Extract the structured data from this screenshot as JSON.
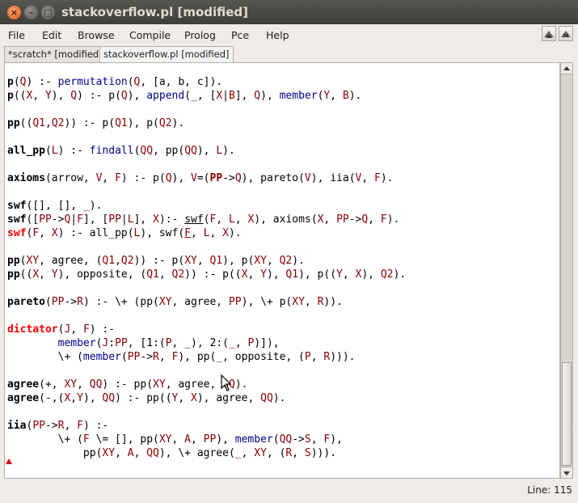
{
  "window": {
    "title": "stackoverflow.pl [modified]",
    "close_glyph": "×",
    "minimize_glyph": "–",
    "maximize_glyph": "□"
  },
  "menu": [
    "File",
    "Edit",
    "Browse",
    "Compile",
    "Prolog",
    "Pce",
    "Help"
  ],
  "toolbar_icons": [
    "split-view-icon",
    "close-view-icon"
  ],
  "tabs": [
    {
      "label": "*scratch* [modified]",
      "active": false
    },
    {
      "label": "stackoverflow.pl [modified]",
      "active": true
    }
  ],
  "code_lines": [
    [
      [
        "p",
        "h"
      ],
      [
        "(",
        "n"
      ],
      [
        "Q",
        "v"
      ],
      [
        ") :- ",
        "n"
      ],
      [
        "permutation",
        "b"
      ],
      [
        "(",
        "n"
      ],
      [
        "Q",
        "v"
      ],
      [
        ", [a, b, c]).",
        "n"
      ]
    ],
    [
      [
        "p",
        "h"
      ],
      [
        "((",
        "n"
      ],
      [
        "X",
        "v"
      ],
      [
        ", ",
        "n"
      ],
      [
        "Y",
        "v"
      ],
      [
        "), ",
        "n"
      ],
      [
        "Q",
        "v"
      ],
      [
        ") :- p(",
        "n"
      ],
      [
        "Q",
        "v"
      ],
      [
        "), ",
        "n"
      ],
      [
        "append",
        "b"
      ],
      [
        "(",
        "n"
      ],
      [
        "_",
        "v"
      ],
      [
        ", [",
        "n"
      ],
      [
        "X",
        "v"
      ],
      [
        "|",
        "n"
      ],
      [
        "B",
        "v"
      ],
      [
        "], ",
        "n"
      ],
      [
        "Q",
        "v"
      ],
      [
        "), ",
        "n"
      ],
      [
        "member",
        "b"
      ],
      [
        "(",
        "n"
      ],
      [
        "Y",
        "v"
      ],
      [
        ", ",
        "n"
      ],
      [
        "B",
        "v"
      ],
      [
        ").",
        "n"
      ]
    ],
    [],
    [
      [
        "pp",
        "h"
      ],
      [
        "((",
        "n"
      ],
      [
        "Q1",
        "v"
      ],
      [
        ",",
        "n"
      ],
      [
        "Q2",
        "v"
      ],
      [
        ")) :- p(",
        "n"
      ],
      [
        "Q1",
        "v"
      ],
      [
        "), p(",
        "n"
      ],
      [
        "Q2",
        "v"
      ],
      [
        ").",
        "n"
      ]
    ],
    [],
    [
      [
        "all_pp",
        "h"
      ],
      [
        "(",
        "n"
      ],
      [
        "L",
        "v"
      ],
      [
        ") :- ",
        "n"
      ],
      [
        "findall",
        "b"
      ],
      [
        "(",
        "n"
      ],
      [
        "QQ",
        "v"
      ],
      [
        ", pp(",
        "n"
      ],
      [
        "QQ",
        "v"
      ],
      [
        "), ",
        "n"
      ],
      [
        "L",
        "v"
      ],
      [
        ").",
        "n"
      ]
    ],
    [],
    [
      [
        "axioms",
        "h"
      ],
      [
        "(arrow, ",
        "n"
      ],
      [
        "V",
        "v"
      ],
      [
        ", ",
        "n"
      ],
      [
        "F",
        "v"
      ],
      [
        ") :- p(",
        "n"
      ],
      [
        "Q",
        "v"
      ],
      [
        "), ",
        "n"
      ],
      [
        "V",
        "v"
      ],
      [
        "=(",
        "n"
      ],
      [
        "PP",
        "hv"
      ],
      [
        "->",
        "n"
      ],
      [
        "Q",
        "v"
      ],
      [
        "), pareto(",
        "n"
      ],
      [
        "V",
        "v"
      ],
      [
        "), iia(",
        "n"
      ],
      [
        "V",
        "v"
      ],
      [
        ", ",
        "n"
      ],
      [
        "F",
        "v"
      ],
      [
        ").",
        "n"
      ]
    ],
    [],
    [
      [
        "swf",
        "h"
      ],
      [
        "([], [], ",
        "n"
      ],
      [
        "_",
        "v"
      ],
      [
        ").",
        "n"
      ]
    ],
    [
      [
        "swf",
        "h"
      ],
      [
        "([",
        "n"
      ],
      [
        "PP",
        "v"
      ],
      [
        "->",
        "n"
      ],
      [
        "Q",
        "v"
      ],
      [
        "|",
        "n"
      ],
      [
        "F",
        "v"
      ],
      [
        "], [",
        "n"
      ],
      [
        "PP",
        "v"
      ],
      [
        "|",
        "n"
      ],
      [
        "L",
        "v"
      ],
      [
        "], ",
        "n"
      ],
      [
        "X",
        "v"
      ],
      [
        "):- ",
        "n"
      ],
      [
        "swf",
        "u"
      ],
      [
        "(",
        "n"
      ],
      [
        "F",
        "v"
      ],
      [
        ", ",
        "n"
      ],
      [
        "L",
        "v"
      ],
      [
        ", ",
        "n"
      ],
      [
        "X",
        "v"
      ],
      [
        "), axioms(",
        "n"
      ],
      [
        "X",
        "v"
      ],
      [
        ", ",
        "n"
      ],
      [
        "PP",
        "v"
      ],
      [
        "->",
        "n"
      ],
      [
        "Q",
        "v"
      ],
      [
        ", ",
        "n"
      ],
      [
        "F",
        "v"
      ],
      [
        ").",
        "n"
      ]
    ],
    [
      [
        "swf",
        "hr"
      ],
      [
        "(",
        "n"
      ],
      [
        "F",
        "v"
      ],
      [
        ", ",
        "n"
      ],
      [
        "X",
        "v"
      ],
      [
        ") :- all_pp(",
        "n"
      ],
      [
        "L",
        "v"
      ],
      [
        "), swf(",
        "n"
      ],
      [
        "F",
        "vu"
      ],
      [
        ", ",
        "n"
      ],
      [
        "L",
        "v"
      ],
      [
        ", ",
        "n"
      ],
      [
        "X",
        "v"
      ],
      [
        ").",
        "n"
      ]
    ],
    [],
    [
      [
        "pp",
        "h"
      ],
      [
        "(",
        "n"
      ],
      [
        "XY",
        "v"
      ],
      [
        ", agree, (",
        "n"
      ],
      [
        "Q1",
        "v"
      ],
      [
        ",",
        "n"
      ],
      [
        "Q2",
        "v"
      ],
      [
        ")) :- p(",
        "n"
      ],
      [
        "XY",
        "v"
      ],
      [
        ", ",
        "n"
      ],
      [
        "Q1",
        "v"
      ],
      [
        "), p(",
        "n"
      ],
      [
        "XY",
        "v"
      ],
      [
        ", ",
        "n"
      ],
      [
        "Q2",
        "v"
      ],
      [
        ").",
        "n"
      ]
    ],
    [
      [
        "pp",
        "h"
      ],
      [
        "((",
        "n"
      ],
      [
        "X",
        "v"
      ],
      [
        ", ",
        "n"
      ],
      [
        "Y",
        "v"
      ],
      [
        "), opposite, (",
        "n"
      ],
      [
        "Q1",
        "v"
      ],
      [
        ", ",
        "n"
      ],
      [
        "Q2",
        "v"
      ],
      [
        ")) :- p((",
        "n"
      ],
      [
        "X",
        "v"
      ],
      [
        ", ",
        "n"
      ],
      [
        "Y",
        "v"
      ],
      [
        "), ",
        "n"
      ],
      [
        "Q1",
        "v"
      ],
      [
        "), p((",
        "n"
      ],
      [
        "Y",
        "v"
      ],
      [
        ", ",
        "n"
      ],
      [
        "X",
        "v"
      ],
      [
        "), ",
        "n"
      ],
      [
        "Q2",
        "v"
      ],
      [
        ").",
        "n"
      ]
    ],
    [],
    [
      [
        "pareto",
        "h"
      ],
      [
        "(",
        "n"
      ],
      [
        "PP",
        "v"
      ],
      [
        "->",
        "n"
      ],
      [
        "R",
        "v"
      ],
      [
        ") :- \\+ (pp(",
        "n"
      ],
      [
        "XY",
        "v"
      ],
      [
        ", agree, ",
        "n"
      ],
      [
        "PP",
        "v"
      ],
      [
        "), \\+ p(",
        "n"
      ],
      [
        "XY",
        "v"
      ],
      [
        ", ",
        "n"
      ],
      [
        "R",
        "v"
      ],
      [
        ")).",
        "n"
      ]
    ],
    [],
    [
      [
        "dictator",
        "hr"
      ],
      [
        "(",
        "n"
      ],
      [
        "J",
        "v"
      ],
      [
        ", ",
        "n"
      ],
      [
        "F",
        "v"
      ],
      [
        ") :-",
        "n"
      ]
    ],
    [
      [
        "        ",
        "n"
      ],
      [
        "member",
        "b"
      ],
      [
        "(",
        "n"
      ],
      [
        "J",
        "v"
      ],
      [
        ":",
        "n"
      ],
      [
        "PP",
        "v"
      ],
      [
        ", [1:(",
        "n"
      ],
      [
        "P",
        "v"
      ],
      [
        ", ",
        "n"
      ],
      [
        "_",
        "v"
      ],
      [
        "), 2:(",
        "n"
      ],
      [
        "_",
        "v"
      ],
      [
        ", ",
        "n"
      ],
      [
        "P",
        "v"
      ],
      [
        ")]),",
        "n"
      ]
    ],
    [
      [
        "        \\+ (",
        "n"
      ],
      [
        "member",
        "b"
      ],
      [
        "(",
        "n"
      ],
      [
        "PP",
        "v"
      ],
      [
        "->",
        "n"
      ],
      [
        "R",
        "v"
      ],
      [
        ", ",
        "n"
      ],
      [
        "F",
        "v"
      ],
      [
        "), pp(",
        "n"
      ],
      [
        "_",
        "v"
      ],
      [
        ", opposite, (",
        "n"
      ],
      [
        "P",
        "v"
      ],
      [
        ", ",
        "n"
      ],
      [
        "R",
        "v"
      ],
      [
        "))).",
        "n"
      ]
    ],
    [],
    [
      [
        "agree",
        "h"
      ],
      [
        "(+, ",
        "n"
      ],
      [
        "XY",
        "v"
      ],
      [
        ", ",
        "n"
      ],
      [
        "QQ",
        "v"
      ],
      [
        ") :- pp(",
        "n"
      ],
      [
        "XY",
        "v"
      ],
      [
        ", agree, ",
        "n"
      ],
      [
        "QQ",
        "v"
      ],
      [
        ").",
        "n"
      ]
    ],
    [
      [
        "agree",
        "h"
      ],
      [
        "(-,(",
        "n"
      ],
      [
        "X",
        "v"
      ],
      [
        ",",
        "n"
      ],
      [
        "Y",
        "v"
      ],
      [
        "), ",
        "n"
      ],
      [
        "QQ",
        "v"
      ],
      [
        ") :- pp((",
        "n"
      ],
      [
        "Y",
        "v"
      ],
      [
        ", ",
        "n"
      ],
      [
        "X",
        "v"
      ],
      [
        "), agree, ",
        "n"
      ],
      [
        "QQ",
        "v"
      ],
      [
        ").",
        "n"
      ]
    ],
    [],
    [
      [
        "iia",
        "h"
      ],
      [
        "(",
        "n"
      ],
      [
        "PP",
        "v"
      ],
      [
        "->",
        "n"
      ],
      [
        "R",
        "v"
      ],
      [
        ", ",
        "n"
      ],
      [
        "F",
        "v"
      ],
      [
        ") :-",
        "n"
      ]
    ],
    [
      [
        "        \\+ (",
        "n"
      ],
      [
        "F",
        "v"
      ],
      [
        " \\= [], pp(",
        "n"
      ],
      [
        "XY",
        "v"
      ],
      [
        ", ",
        "n"
      ],
      [
        "A",
        "v"
      ],
      [
        ", ",
        "n"
      ],
      [
        "PP",
        "v"
      ],
      [
        "), ",
        "n"
      ],
      [
        "member",
        "b"
      ],
      [
        "(",
        "n"
      ],
      [
        "QQ",
        "v"
      ],
      [
        "->",
        "n"
      ],
      [
        "S",
        "v"
      ],
      [
        ", ",
        "n"
      ],
      [
        "F",
        "v"
      ],
      [
        "),",
        "n"
      ]
    ],
    [
      [
        "            pp(",
        "n"
      ],
      [
        "XY",
        "v"
      ],
      [
        ", ",
        "n"
      ],
      [
        "A",
        "v"
      ],
      [
        ", ",
        "n"
      ],
      [
        "QQ",
        "v"
      ],
      [
        "), \\+ agree(",
        "n"
      ],
      [
        "_",
        "v"
      ],
      [
        ", ",
        "n"
      ],
      [
        "XY",
        "v"
      ],
      [
        ", (",
        "n"
      ],
      [
        "R",
        "v"
      ],
      [
        ", ",
        "n"
      ],
      [
        "S",
        "v"
      ],
      [
        "))).",
        "n"
      ]
    ]
  ],
  "status": {
    "line": "Line: 115"
  },
  "colors": {
    "variable": "#8b0000",
    "builtin": "#00008b",
    "error_head": "#ff0000"
  }
}
